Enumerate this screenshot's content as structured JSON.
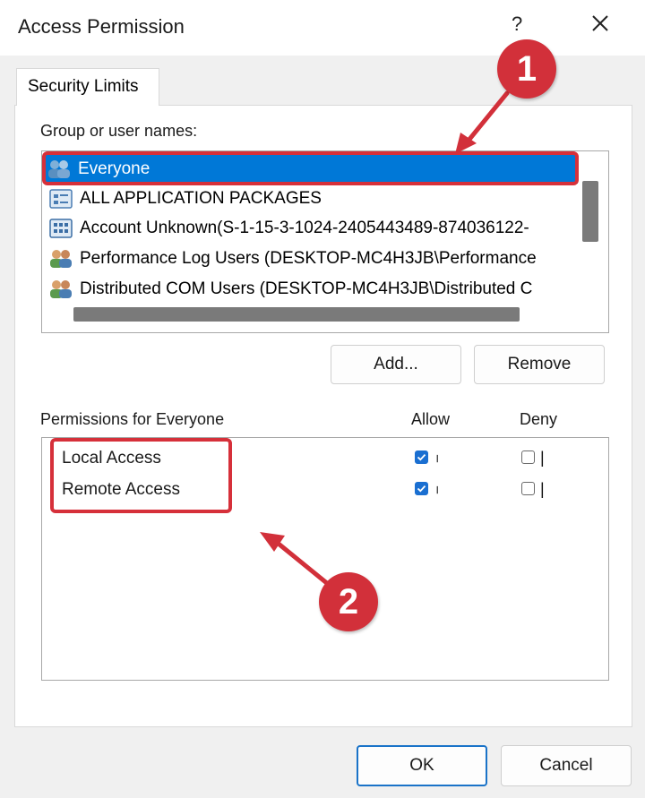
{
  "window": {
    "title": "Access Permission",
    "help_label": "?",
    "close_icon": "close-icon"
  },
  "tab": {
    "label": "Security Limits"
  },
  "groups": {
    "label": "Group or user names:",
    "items": [
      {
        "label": "Everyone",
        "icon": "users-group-icon",
        "selected": true
      },
      {
        "label": "ALL APPLICATION PACKAGES",
        "icon": "app-packages-icon",
        "selected": false
      },
      {
        "label": "Account Unknown(S-1-15-3-1024-2405443489-874036122-",
        "icon": "unknown-account-icon",
        "selected": false
      },
      {
        "label": "Performance Log Users (DESKTOP-MC4H3JB\\Performance",
        "icon": "users-group-icon",
        "selected": false
      },
      {
        "label": "Distributed COM Users (DESKTOP-MC4H3JB\\Distributed C",
        "icon": "users-group-icon",
        "selected": false
      }
    ],
    "add_label": "Add...",
    "remove_label": "Remove"
  },
  "permissions": {
    "label": "Permissions for Everyone",
    "allow_header": "Allow",
    "deny_header": "Deny",
    "rows": [
      {
        "label": "Local Access",
        "allow": true,
        "deny": false
      },
      {
        "label": "Remote Access",
        "allow": true,
        "deny": false
      }
    ]
  },
  "footer": {
    "ok_label": "OK",
    "cancel_label": "Cancel"
  },
  "annotations": {
    "badge_1": "1",
    "badge_2": "2",
    "color": "#d2303a"
  },
  "colors": {
    "selection": "#0078d7",
    "checkbox_on": "#1a6fd1",
    "ok_border": "#1a73c8"
  }
}
